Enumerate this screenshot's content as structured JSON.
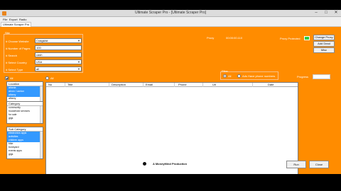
{
  "window": {
    "title": "Ultimate Scraper Pro - [Ultimate Scraper Pro]",
    "controls": [
      "–",
      "□",
      "✕"
    ]
  },
  "menu": [
    "File",
    "Export",
    "Radio"
  ],
  "tab": "Ultimate Scraper Pro",
  "form": {
    "section_label": "Site",
    "fields": [
      {
        "label": "# Choose Website",
        "value": "Craigslist",
        "kind": "select"
      },
      {
        "label": "# Number of Pages",
        "value": "100",
        "kind": "input"
      },
      {
        "label": "# Search",
        "value": "cash",
        "kind": "input"
      },
      {
        "label": "# Select Country",
        "value": "USA",
        "kind": "select"
      },
      {
        "label": "# Select Type",
        "value": "all",
        "kind": "select"
      }
    ]
  },
  "proxy": {
    "label": "Proxy",
    "value": "00:00:00.110",
    "protected_label": "Proxy Protected",
    "status_color": "#2ecc40",
    "buttons": [
      "Change Proxy",
      "Add Dead",
      "Misc"
    ]
  },
  "left_panel": {
    "all_label": "All",
    "locations": {
      "header": "Location",
      "items": [
        {
          "text": "atlanta",
          "selected": true
        },
        {
          "text": "akron / canton",
          "selected": true
        },
        {
          "text": "albany",
          "selected": true
        },
        {
          "text": "albany",
          "selected": false
        }
      ]
    },
    "categories": {
      "header": "Category",
      "items": [
        "community",
        "household services",
        "for sale",
        "gigs"
      ]
    },
    "sub_categories": {
      "header": "Sub Category",
      "items": [
        {
          "text": "electronics apps",
          "selected": true
        },
        {
          "text": "activities",
          "selected": true
        },
        {
          "text": "children apps",
          "selected": true
        },
        {
          "text": "bike",
          "selected": false
        },
        {
          "text": "boneyard",
          "selected": false
        },
        {
          "text": "events apps",
          "selected": false
        },
        {
          "text": "gigs",
          "selected": false
        }
      ]
    }
  },
  "filter": {
    "label": "Filter",
    "options": [
      {
        "label": "All",
        "checked": true
      },
      {
        "label": "Ads Have phone numbers",
        "checked": false
      }
    ],
    "progress_label": "Progress",
    "progress": 0
  },
  "grid": {
    "all_label": "All",
    "columns": [
      "No",
      "Title",
      "Description",
      "Email",
      "Phone",
      "Url",
      "Date"
    ]
  },
  "footer": {
    "credit": "A MoneyMind Production",
    "buttons": [
      "Run",
      "Close"
    ]
  },
  "colors": {
    "background": "#ff8c00",
    "selected": "#3399ff"
  }
}
